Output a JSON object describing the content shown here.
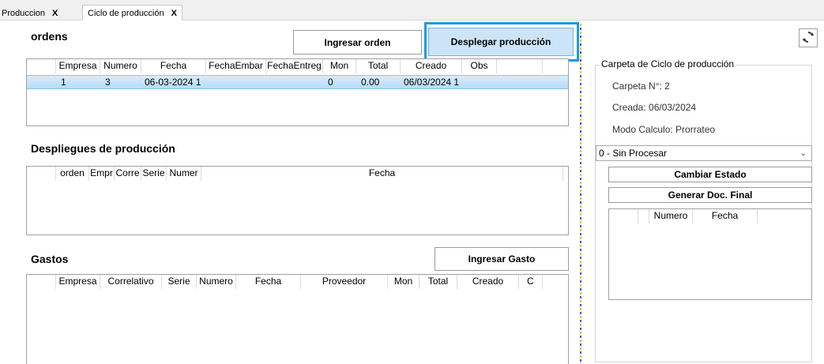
{
  "tabs": [
    {
      "label": "Produccion",
      "close": "X"
    },
    {
      "label": "Ciclo de producción",
      "close": "X"
    }
  ],
  "ordenes": {
    "title": "ordens",
    "btn_ingresar": "Ingresar orden",
    "btn_desplegar": "Desplegar producción",
    "columns": [
      "Empresa",
      "Numero",
      "Fecha",
      "FechaEmbar",
      "FechaEntreg",
      "Mon",
      "Total",
      "Creado",
      "Obs"
    ],
    "rows": [
      [
        "1",
        "3",
        "06-03-2024 1",
        "",
        "",
        "0",
        "0.00",
        "06/03/2024 1",
        ""
      ]
    ]
  },
  "despliegues": {
    "title": "Despliegues de producción",
    "columns": [
      "orden",
      "Empr",
      "Corre",
      "Serie",
      "Numer",
      "Fecha"
    ]
  },
  "gastos": {
    "title": "Gastos",
    "btn_ingresar": "Ingresar Gasto",
    "columns": [
      "Empresa",
      "Correlativo",
      "Serie",
      "Numero",
      "Fecha",
      "Proveedor",
      "Mon",
      "Total",
      "Creado",
      "C"
    ]
  },
  "carpeta": {
    "legend": "Carpeta de Ciclo de producción",
    "numero": "Carpeta N°: 2",
    "creada": "Creada: 06/03/2024",
    "modo": "Modo Calculo: Prorrateo",
    "estado_value": "0 - Sin Procesar",
    "btn_cambiar": "Cambiar Estado",
    "btn_generar": "Generar Doc. Final",
    "doc_columns": [
      "Numero",
      "Fecha"
    ]
  },
  "icons": {
    "refresh": "refresh-icon",
    "dropdown": "chevron-down-icon"
  },
  "colors": {
    "accent": "#1a9ae0",
    "selection": "#b6dbf7"
  }
}
